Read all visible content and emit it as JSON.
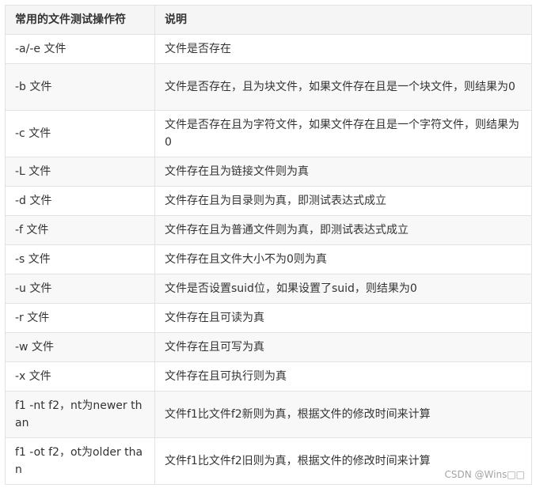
{
  "table": {
    "headers": [
      "常用的文件测试操作符",
      "说明"
    ],
    "rows": [
      {
        "op": "-a/-e 文件",
        "desc": "文件是否存在",
        "lines": 1
      },
      {
        "op": "-b 文件",
        "desc": "文件是否存在，且为块文件，如果文件存在且是一个块文件，则结果为0",
        "lines": 2
      },
      {
        "op": "-c 文件",
        "desc": "文件是否存在且为字符文件，如果文件存在且是一个字符文件，则结果为0",
        "lines": 2
      },
      {
        "op": "-L 文件",
        "desc": "文件存在且为链接文件则为真",
        "lines": 1
      },
      {
        "op": "-d 文件",
        "desc": "文件存在且为目录则为真，即测试表达式成立",
        "lines": 1
      },
      {
        "op": "-f 文件",
        "desc": "文件存在且为普通文件则为真，即测试表达式成立",
        "lines": 1
      },
      {
        "op": "-s 文件",
        "desc": "文件存在且文件大小不为0则为真",
        "lines": 1
      },
      {
        "op": "-u 文件",
        "desc": "文件是否设置suid位，如果设置了suid，则结果为0",
        "lines": 1
      },
      {
        "op": "-r 文件",
        "desc": "文件存在且可读为真",
        "lines": 1
      },
      {
        "op": "-w 文件",
        "desc": "文件存在且可写为真",
        "lines": 1
      },
      {
        "op": "-x 文件",
        "desc": "文件存在且可执行则为真",
        "lines": 1
      },
      {
        "op": "f1 -nt f2，nt为newer than",
        "desc": "文件f1比文件f2新则为真，根据文件的修改时间来计算",
        "lines": 2
      },
      {
        "op": "f1 -ot f2，ot为older than",
        "desc": "文件f1比文件f2旧则为真，根据文件的修改时间来计算",
        "lines": 2
      }
    ]
  },
  "watermark": "CSDN @Wins□□"
}
